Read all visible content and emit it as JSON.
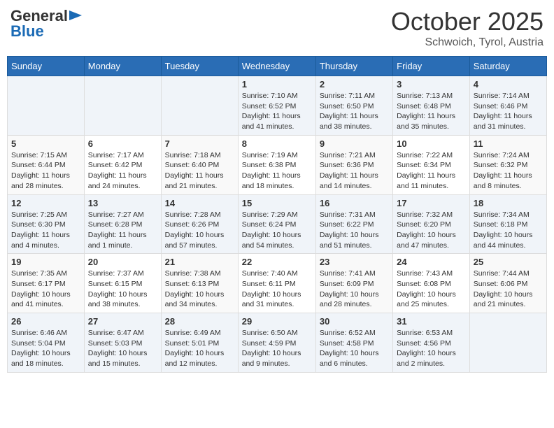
{
  "header": {
    "logo_general": "General",
    "logo_blue": "Blue",
    "month": "October 2025",
    "location": "Schwoich, Tyrol, Austria"
  },
  "days_of_week": [
    "Sunday",
    "Monday",
    "Tuesday",
    "Wednesday",
    "Thursday",
    "Friday",
    "Saturday"
  ],
  "weeks": [
    [
      {
        "day": "",
        "sunrise": "",
        "sunset": "",
        "daylight": ""
      },
      {
        "day": "",
        "sunrise": "",
        "sunset": "",
        "daylight": ""
      },
      {
        "day": "",
        "sunrise": "",
        "sunset": "",
        "daylight": ""
      },
      {
        "day": "1",
        "sunrise": "Sunrise: 7:10 AM",
        "sunset": "Sunset: 6:52 PM",
        "daylight": "Daylight: 11 hours and 41 minutes."
      },
      {
        "day": "2",
        "sunrise": "Sunrise: 7:11 AM",
        "sunset": "Sunset: 6:50 PM",
        "daylight": "Daylight: 11 hours and 38 minutes."
      },
      {
        "day": "3",
        "sunrise": "Sunrise: 7:13 AM",
        "sunset": "Sunset: 6:48 PM",
        "daylight": "Daylight: 11 hours and 35 minutes."
      },
      {
        "day": "4",
        "sunrise": "Sunrise: 7:14 AM",
        "sunset": "Sunset: 6:46 PM",
        "daylight": "Daylight: 11 hours and 31 minutes."
      }
    ],
    [
      {
        "day": "5",
        "sunrise": "Sunrise: 7:15 AM",
        "sunset": "Sunset: 6:44 PM",
        "daylight": "Daylight: 11 hours and 28 minutes."
      },
      {
        "day": "6",
        "sunrise": "Sunrise: 7:17 AM",
        "sunset": "Sunset: 6:42 PM",
        "daylight": "Daylight: 11 hours and 24 minutes."
      },
      {
        "day": "7",
        "sunrise": "Sunrise: 7:18 AM",
        "sunset": "Sunset: 6:40 PM",
        "daylight": "Daylight: 11 hours and 21 minutes."
      },
      {
        "day": "8",
        "sunrise": "Sunrise: 7:19 AM",
        "sunset": "Sunset: 6:38 PM",
        "daylight": "Daylight: 11 hours and 18 minutes."
      },
      {
        "day": "9",
        "sunrise": "Sunrise: 7:21 AM",
        "sunset": "Sunset: 6:36 PM",
        "daylight": "Daylight: 11 hours and 14 minutes."
      },
      {
        "day": "10",
        "sunrise": "Sunrise: 7:22 AM",
        "sunset": "Sunset: 6:34 PM",
        "daylight": "Daylight: 11 hours and 11 minutes."
      },
      {
        "day": "11",
        "sunrise": "Sunrise: 7:24 AM",
        "sunset": "Sunset: 6:32 PM",
        "daylight": "Daylight: 11 hours and 8 minutes."
      }
    ],
    [
      {
        "day": "12",
        "sunrise": "Sunrise: 7:25 AM",
        "sunset": "Sunset: 6:30 PM",
        "daylight": "Daylight: 11 hours and 4 minutes."
      },
      {
        "day": "13",
        "sunrise": "Sunrise: 7:27 AM",
        "sunset": "Sunset: 6:28 PM",
        "daylight": "Daylight: 11 hours and 1 minute."
      },
      {
        "day": "14",
        "sunrise": "Sunrise: 7:28 AM",
        "sunset": "Sunset: 6:26 PM",
        "daylight": "Daylight: 10 hours and 57 minutes."
      },
      {
        "day": "15",
        "sunrise": "Sunrise: 7:29 AM",
        "sunset": "Sunset: 6:24 PM",
        "daylight": "Daylight: 10 hours and 54 minutes."
      },
      {
        "day": "16",
        "sunrise": "Sunrise: 7:31 AM",
        "sunset": "Sunset: 6:22 PM",
        "daylight": "Daylight: 10 hours and 51 minutes."
      },
      {
        "day": "17",
        "sunrise": "Sunrise: 7:32 AM",
        "sunset": "Sunset: 6:20 PM",
        "daylight": "Daylight: 10 hours and 47 minutes."
      },
      {
        "day": "18",
        "sunrise": "Sunrise: 7:34 AM",
        "sunset": "Sunset: 6:18 PM",
        "daylight": "Daylight: 10 hours and 44 minutes."
      }
    ],
    [
      {
        "day": "19",
        "sunrise": "Sunrise: 7:35 AM",
        "sunset": "Sunset: 6:17 PM",
        "daylight": "Daylight: 10 hours and 41 minutes."
      },
      {
        "day": "20",
        "sunrise": "Sunrise: 7:37 AM",
        "sunset": "Sunset: 6:15 PM",
        "daylight": "Daylight: 10 hours and 38 minutes."
      },
      {
        "day": "21",
        "sunrise": "Sunrise: 7:38 AM",
        "sunset": "Sunset: 6:13 PM",
        "daylight": "Daylight: 10 hours and 34 minutes."
      },
      {
        "day": "22",
        "sunrise": "Sunrise: 7:40 AM",
        "sunset": "Sunset: 6:11 PM",
        "daylight": "Daylight: 10 hours and 31 minutes."
      },
      {
        "day": "23",
        "sunrise": "Sunrise: 7:41 AM",
        "sunset": "Sunset: 6:09 PM",
        "daylight": "Daylight: 10 hours and 28 minutes."
      },
      {
        "day": "24",
        "sunrise": "Sunrise: 7:43 AM",
        "sunset": "Sunset: 6:08 PM",
        "daylight": "Daylight: 10 hours and 25 minutes."
      },
      {
        "day": "25",
        "sunrise": "Sunrise: 7:44 AM",
        "sunset": "Sunset: 6:06 PM",
        "daylight": "Daylight: 10 hours and 21 minutes."
      }
    ],
    [
      {
        "day": "26",
        "sunrise": "Sunrise: 6:46 AM",
        "sunset": "Sunset: 5:04 PM",
        "daylight": "Daylight: 10 hours and 18 minutes."
      },
      {
        "day": "27",
        "sunrise": "Sunrise: 6:47 AM",
        "sunset": "Sunset: 5:03 PM",
        "daylight": "Daylight: 10 hours and 15 minutes."
      },
      {
        "day": "28",
        "sunrise": "Sunrise: 6:49 AM",
        "sunset": "Sunset: 5:01 PM",
        "daylight": "Daylight: 10 hours and 12 minutes."
      },
      {
        "day": "29",
        "sunrise": "Sunrise: 6:50 AM",
        "sunset": "Sunset: 4:59 PM",
        "daylight": "Daylight: 10 hours and 9 minutes."
      },
      {
        "day": "30",
        "sunrise": "Sunrise: 6:52 AM",
        "sunset": "Sunset: 4:58 PM",
        "daylight": "Daylight: 10 hours and 6 minutes."
      },
      {
        "day": "31",
        "sunrise": "Sunrise: 6:53 AM",
        "sunset": "Sunset: 4:56 PM",
        "daylight": "Daylight: 10 hours and 2 minutes."
      },
      {
        "day": "",
        "sunrise": "",
        "sunset": "",
        "daylight": ""
      }
    ]
  ]
}
